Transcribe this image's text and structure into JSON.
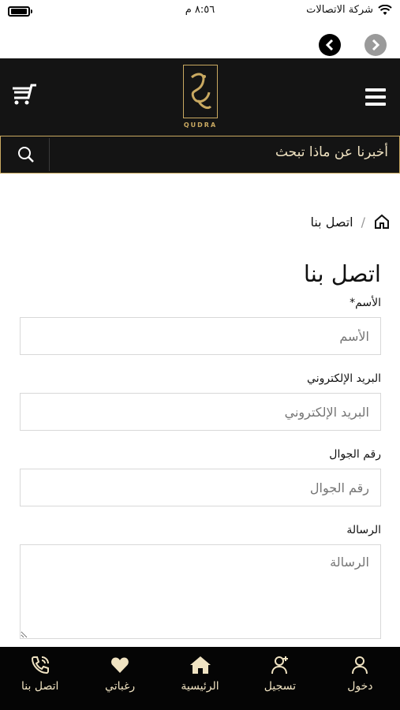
{
  "status_bar": {
    "carrier": "شركة الاتصالات",
    "time": "٨:٥٦ م"
  },
  "header": {
    "logo_text": "QUDRA"
  },
  "search": {
    "placeholder": "أخبرنا عن ماذا تبحث"
  },
  "breadcrumb": {
    "current": "اتصل بنا",
    "separator": "/"
  },
  "form": {
    "title": "اتصل بنا",
    "fields": [
      {
        "label": "الأسم*",
        "placeholder": "الأسم"
      },
      {
        "label": "البريد الإلكتروني",
        "placeholder": "البريد الإلكتروني"
      },
      {
        "label": "رقم الجوال",
        "placeholder": "رقم الجوال"
      },
      {
        "label": "الرسالة",
        "placeholder": "الرسالة"
      }
    ]
  },
  "bottom_nav": [
    {
      "label": "دخول",
      "icon": "user-icon"
    },
    {
      "label": "تسجيل",
      "icon": "user-plus-icon"
    },
    {
      "label": "الرئيسية",
      "icon": "home-icon"
    },
    {
      "label": "رغباتي",
      "icon": "heart-icon"
    },
    {
      "label": "اتصل بنا",
      "icon": "phone-icon"
    }
  ],
  "colors": {
    "header_bg": "#141414",
    "accent_gold": "#c9a961",
    "nav_text": "#f0e3c2"
  }
}
